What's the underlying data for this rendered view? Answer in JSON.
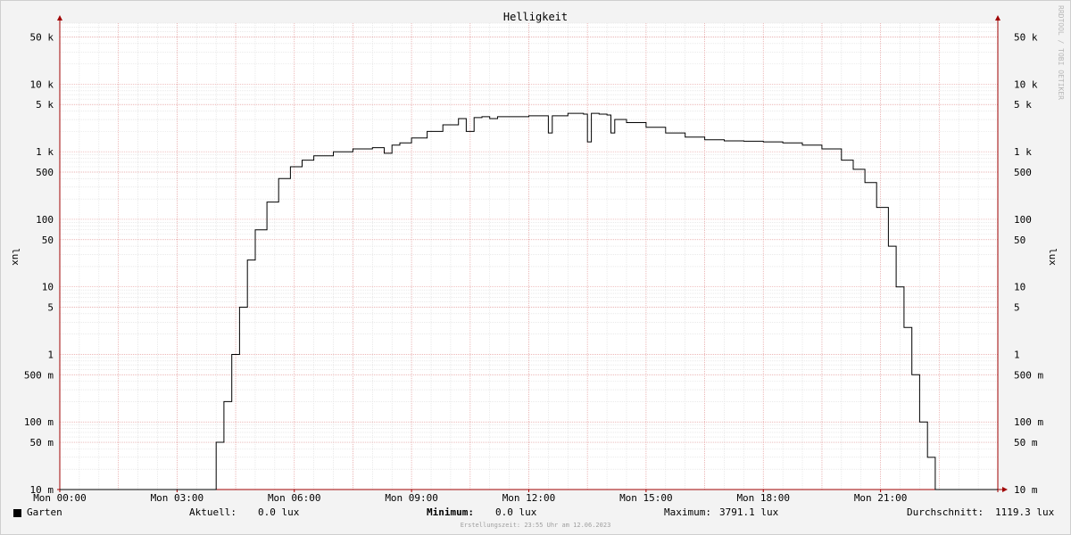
{
  "chart_data": {
    "type": "line",
    "title": "Helligkeit",
    "ylabel": "lux",
    "yscale": "log",
    "ylim": [
      0.01,
      80000
    ],
    "xlim": [
      0,
      24
    ],
    "x_ticks": [
      {
        "h": 0,
        "label": "Mon 00:00"
      },
      {
        "h": 3,
        "label": "Mon 03:00"
      },
      {
        "h": 6,
        "label": "Mon 06:00"
      },
      {
        "h": 9,
        "label": "Mon 09:00"
      },
      {
        "h": 12,
        "label": "Mon 12:00"
      },
      {
        "h": 15,
        "label": "Mon 15:00"
      },
      {
        "h": 18,
        "label": "Mon 18:00"
      },
      {
        "h": 21,
        "label": "Mon 21:00"
      }
    ],
    "y_ticks": [
      {
        "v": 0.01,
        "label": "10 m"
      },
      {
        "v": 0.05,
        "label": "50 m"
      },
      {
        "v": 0.1,
        "label": "100 m"
      },
      {
        "v": 0.5,
        "label": "500 m"
      },
      {
        "v": 1,
        "label": "1"
      },
      {
        "v": 5,
        "label": "5"
      },
      {
        "v": 10,
        "label": "10"
      },
      {
        "v": 50,
        "label": "50"
      },
      {
        "v": 100,
        "label": "100"
      },
      {
        "v": 500,
        "label": "500"
      },
      {
        "v": 1000,
        "label": "1 k"
      },
      {
        "v": 5000,
        "label": "5 k"
      },
      {
        "v": 10000,
        "label": "10 k"
      },
      {
        "v": 50000,
        "label": "50 k"
      }
    ],
    "grid": true,
    "series": [
      {
        "name": "Garten",
        "color": "#000000",
        "x": [
          0,
          3.9,
          4.0,
          4.2,
          4.4,
          4.6,
          4.8,
          5.0,
          5.3,
          5.6,
          5.9,
          6.2,
          6.5,
          7.0,
          7.5,
          8.0,
          8.3,
          8.5,
          8.7,
          9.0,
          9.4,
          9.8,
          10.2,
          10.4,
          10.6,
          10.8,
          11.0,
          11.2,
          11.6,
          12.0,
          12.4,
          12.5,
          12.6,
          13.0,
          13.4,
          13.5,
          13.6,
          13.8,
          14.0,
          14.1,
          14.2,
          14.5,
          15.0,
          15.5,
          16.0,
          16.5,
          17.0,
          17.5,
          18.0,
          18.5,
          19.0,
          19.5,
          20.0,
          20.3,
          20.6,
          20.9,
          21.2,
          21.4,
          21.6,
          21.8,
          22.0,
          22.2,
          22.4,
          22.6,
          22.8,
          22.9,
          23.0,
          23.1,
          23.2,
          24.0
        ],
        "y": [
          0.01,
          0.01,
          0.05,
          0.2,
          1.0,
          5,
          25,
          70,
          180,
          400,
          600,
          750,
          870,
          1000,
          1100,
          1150,
          950,
          1250,
          1350,
          1600,
          2000,
          2500,
          3100,
          2000,
          3200,
          3300,
          3100,
          3300,
          3300,
          3400,
          3400,
          1900,
          3400,
          3700,
          3600,
          1400,
          3700,
          3600,
          3500,
          1900,
          3000,
          2700,
          2300,
          1900,
          1650,
          1500,
          1450,
          1430,
          1400,
          1350,
          1250,
          1100,
          750,
          550,
          350,
          150,
          40,
          10,
          2.5,
          0.5,
          0.1,
          0.03,
          0.01,
          0.01,
          0.01,
          0.01,
          0.01,
          0.01,
          0.01,
          0.01
        ]
      }
    ]
  },
  "side_text": "RRDTOOL / TOBI OETIKER",
  "legend": {
    "series_name": "Garten",
    "current_label": "Aktuell:",
    "current_value": "0.0 lux",
    "min_label": "Minimum:",
    "min_value": "0.0 lux",
    "max_label": "Maximum:",
    "max_value": "3791.1 lux",
    "avg_label": "Durchschnitt:",
    "avg_value": "1119.3 lux"
  },
  "footer": "Erstellungszeit: 23:55 Uhr am 12.06.2023"
}
